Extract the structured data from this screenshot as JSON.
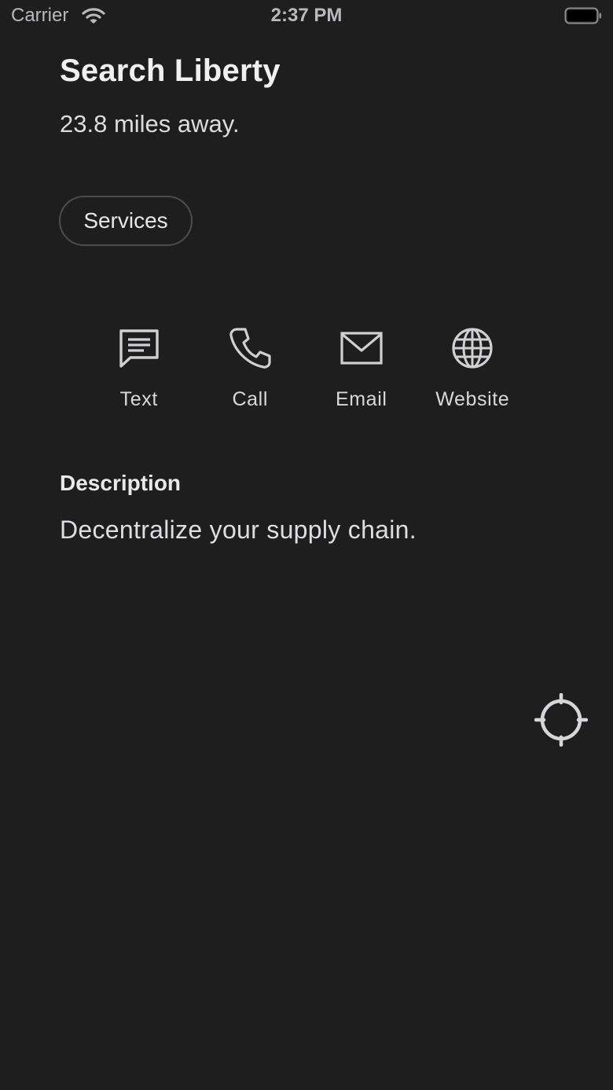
{
  "status_bar": {
    "carrier": "Carrier",
    "time": "2:37 PM",
    "wifi_icon": "wifi-icon",
    "battery_icon": "battery-icon"
  },
  "place": {
    "title": "Search Liberty",
    "distance": "23.8 miles away."
  },
  "chip": {
    "label": "Services"
  },
  "actions": [
    {
      "label": "Text",
      "icon": "message-icon"
    },
    {
      "label": "Call",
      "icon": "phone-icon"
    },
    {
      "label": "Email",
      "icon": "envelope-icon"
    },
    {
      "label": "Website",
      "icon": "globe-icon"
    }
  ],
  "description": {
    "heading": "Description",
    "body": "Decentralize your supply chain."
  },
  "locate": {
    "icon": "crosshair-icon"
  },
  "colors": {
    "background": "#1e1e1f",
    "icon": "#d0d0d2"
  }
}
